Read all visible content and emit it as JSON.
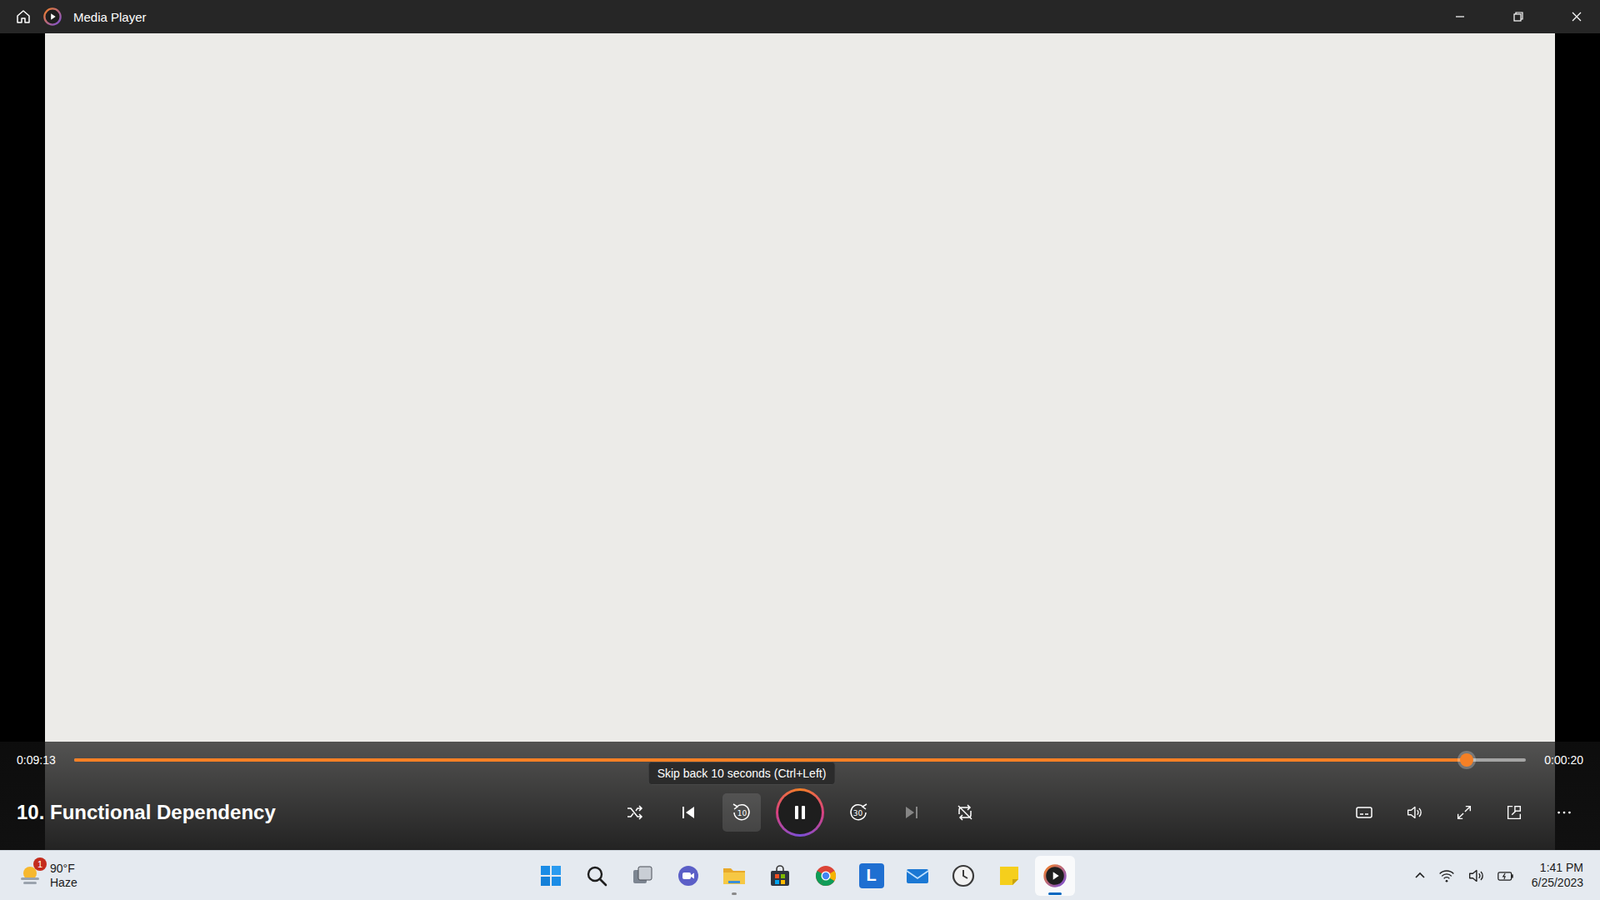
{
  "window": {
    "title": "Media Player"
  },
  "player": {
    "elapsed": "0:09:13",
    "remaining": "0:00:20",
    "level": 0.959,
    "title": "10. Functional Dependency",
    "controls": [
      {
        "kind": "shuffle",
        "disabled": false,
        "hovered": false
      },
      {
        "kind": "previous",
        "disabled": false,
        "hovered": false
      },
      {
        "kind": "skip-back",
        "label": "10",
        "disabled": false,
        "hovered": true,
        "tooltip": "Skip back 10 seconds (Ctrl+Left)"
      },
      {
        "kind": "play-pause",
        "playing": true,
        "disabled": false,
        "hovered": false
      },
      {
        "kind": "skip-forward",
        "label": "30",
        "disabled": false,
        "hovered": false
      },
      {
        "kind": "next",
        "disabled": true,
        "hovered": false
      },
      {
        "kind": "repeat",
        "disabled": false,
        "hovered": false
      }
    ]
  },
  "taskbar": {
    "weather": {
      "temp": "90°F",
      "condition": "Haze",
      "badge": "1"
    },
    "apps": [
      {
        "kind": "start",
        "running": false,
        "selected": false
      },
      {
        "kind": "search",
        "running": false,
        "selected": false
      },
      {
        "kind": "task-view",
        "running": false,
        "selected": false
      },
      {
        "kind": "meet",
        "running": false,
        "selected": false
      },
      {
        "kind": "explorer",
        "running": true,
        "selected": false
      },
      {
        "kind": "store",
        "running": false,
        "selected": false
      },
      {
        "kind": "chrome",
        "running": false,
        "selected": false
      },
      {
        "kind": "launcher",
        "label": "L",
        "running": false,
        "selected": false
      },
      {
        "kind": "mail",
        "running": false,
        "selected": false
      },
      {
        "kind": "clock",
        "running": false,
        "selected": false
      },
      {
        "kind": "sticky-notes",
        "running": false,
        "selected": false
      },
      {
        "kind": "media-player",
        "running": true,
        "selected": true
      }
    ],
    "clock": {
      "time": "1:41 PM",
      "date": "6/25/2023"
    }
  }
}
